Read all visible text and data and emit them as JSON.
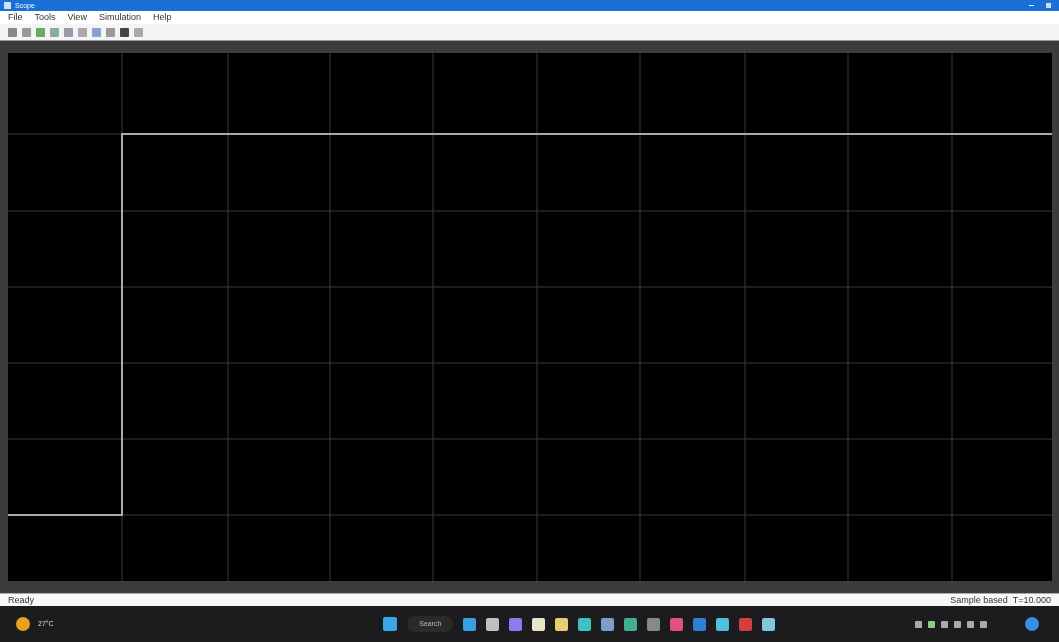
{
  "window": {
    "title": "Scope"
  },
  "menu": [
    "File",
    "Tools",
    "View",
    "Simulation",
    "Help"
  ],
  "status_bar": {
    "left": "Ready",
    "right": "Sample based  T=10.000"
  },
  "taskbar": {
    "weather": "27°C",
    "search": "Search"
  }
}
